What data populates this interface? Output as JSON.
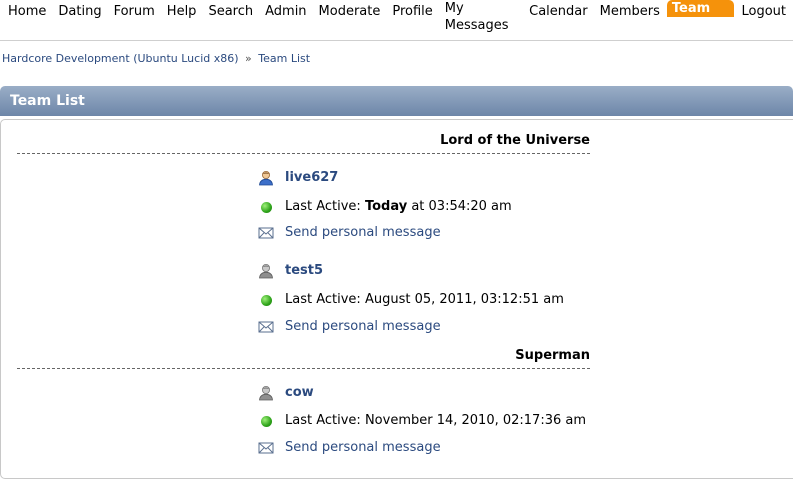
{
  "nav": {
    "items": [
      "Home",
      "Dating",
      "Forum",
      "Help",
      "Search",
      "Admin",
      "Moderate",
      "Profile",
      "My Messages",
      "Calendar",
      "Members",
      "Team List",
      "Logout"
    ],
    "active": "Team List"
  },
  "breadcrumb": {
    "home": "Hardcore Development (Ubuntu Lucid x86)",
    "separator": "»",
    "current": "Team List"
  },
  "page": {
    "title": "Team List"
  },
  "groups": [
    {
      "title": "Lord of the Universe",
      "members": [
        {
          "name": "live627",
          "avatar": "user-blue-icon",
          "last_active_label": "Last Active:",
          "last_active_prefix": "Today",
          "last_active_value": "at 03:54:20 am",
          "pm_label": "Send personal message"
        },
        {
          "name": "test5",
          "avatar": "user-gray-icon",
          "last_active_label": "Last Active:",
          "last_active_value": "August 05, 2011, 03:12:51 am",
          "pm_label": "Send personal message"
        }
      ]
    },
    {
      "title": "Superman",
      "members": [
        {
          "name": "cow",
          "avatar": "user-gray-icon",
          "last_active_label": "Last Active:",
          "last_active_value": "November 14, 2010, 02:17:36 am",
          "pm_label": "Send personal message"
        }
      ]
    }
  ],
  "colors": {
    "active_tab": "#f5920b",
    "link": "#2b4a7f",
    "titlebar": "#6d86a8",
    "online": "#2ea31a"
  }
}
